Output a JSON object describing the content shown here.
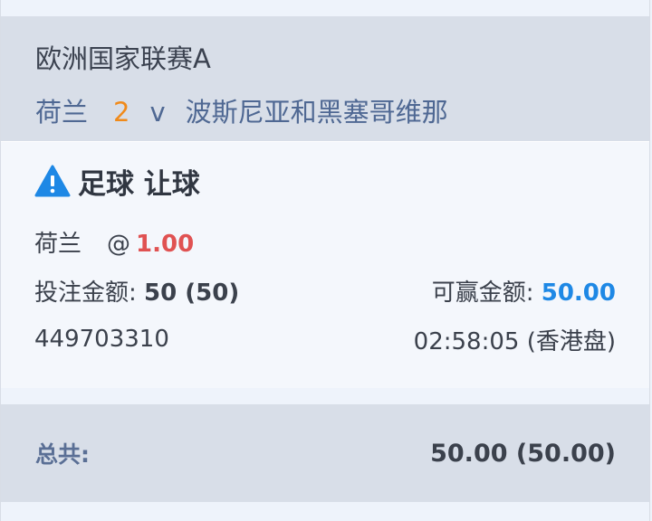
{
  "match": {
    "league": "欧洲国家联赛A",
    "home_team": "荷兰",
    "score": "2",
    "vs": "v",
    "away_team": "波斯尼亚和黑塞哥维那"
  },
  "bet": {
    "warning_icon": "warning-triangle-icon",
    "title": "足球 让球",
    "selection": "荷兰",
    "odds_at": "@",
    "odds": "1.00",
    "stake_label": "投注金额:",
    "stake_value": "50 (50)",
    "win_label": "可赢金额:",
    "win_value": "50.00",
    "ticket_id": "449703310",
    "time": "02:58:05 (香港盘)"
  },
  "total": {
    "label": "总共:",
    "value": "50.00 (50.00)"
  },
  "colors": {
    "header_bg": "#d8dee8",
    "card_bg": "#f4f7fc",
    "score": "#f08a1a",
    "team": "#4f6893",
    "odds": "#e05252",
    "win": "#1e88e5",
    "warning": "#1e88e5"
  }
}
